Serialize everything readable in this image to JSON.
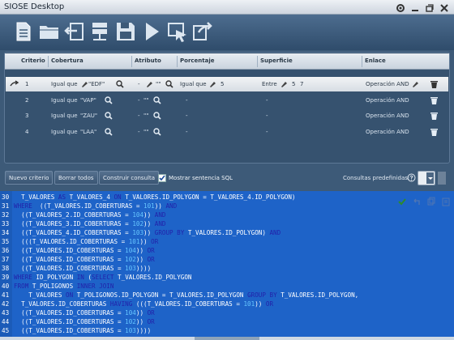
{
  "window": {
    "title": "SIOSE Desktop"
  },
  "toolbar": {
    "buttons": [
      {
        "icon": "new-document-icon"
      },
      {
        "icon": "open-folder-icon"
      },
      {
        "icon": "import-arrow-icon"
      },
      {
        "icon": "database-server-icon"
      },
      {
        "icon": "save-disk-icon"
      },
      {
        "icon": "run-play-icon"
      },
      {
        "icon": "select-cursor-icon"
      },
      {
        "icon": "export-arrow-icon"
      }
    ]
  },
  "grid": {
    "columns": [
      "Criterio",
      "Cobertura",
      "Atributo",
      "Porcentaje",
      "Superficie",
      "Enlace"
    ],
    "rows": [
      {
        "criterio": "1",
        "cobertura": "Igual que ",
        "cobertura_value": "\"EDF\"",
        "atributo": "-",
        "atributo_value": "\"\"",
        "porcentaje": "Igual que",
        "porcentaje_value": "5",
        "superficie": "Entre",
        "sup_min": "5",
        "sup_max": "7",
        "enlace": "Operación AND",
        "selected": true
      },
      {
        "criterio": "2",
        "cobertura": "Igual que ",
        "cobertura_value": "\"VAP\"",
        "atributo": "-",
        "atributo_value": "\"\"",
        "porcentaje": "-",
        "superficie": "-",
        "enlace": "Operación AND",
        "selected": false
      },
      {
        "criterio": "3",
        "cobertura": "Igual que ",
        "cobertura_value": "\"ZAU\"",
        "atributo": "-",
        "atributo_value": "\"\"",
        "porcentaje": "-",
        "superficie": "-",
        "enlace": "Operación AND",
        "selected": false
      },
      {
        "criterio": "4",
        "cobertura": "Igual que ",
        "cobertura_value": "\"LAA\"",
        "atributo": "-",
        "atributo_value": "\"\"",
        "porcentaje": "-",
        "superficie": "-",
        "enlace": "Operación AND",
        "selected": false
      }
    ]
  },
  "actions": {
    "new_criterion": "Nuevo criterio",
    "delete_all": "Borrar todos",
    "build_query": "Construir consulta",
    "show_sql": "Mostrar sentencia SQL",
    "show_sql_checked": true,
    "predefined_label": "Consultas predefinidas:"
  },
  "sql": {
    "lines": [
      {
        "n": "30",
        "t": [
          [
            "  T_VALORES ",
            ""
          ],
          [
            "AS",
            "kw"
          ],
          [
            " T_VALORES_4 ",
            ""
          ],
          [
            "ON",
            "kw"
          ],
          [
            " T_VALORES.ID_POLYGON = T_VALORES_4.ID_POLYGON)",
            ""
          ]
        ]
      },
      {
        "n": "31",
        "t": [
          [
            "WHERE",
            "kw"
          ],
          [
            "  ((T_VALORES.ID_COBERTURAS = ",
            ""
          ],
          [
            "101",
            "num"
          ],
          [
            ")) ",
            ""
          ],
          [
            "AND",
            "kw"
          ]
        ]
      },
      {
        "n": "32",
        "t": [
          [
            "  ((T_VALORES_2.ID_COBERTURAS = ",
            ""
          ],
          [
            "104",
            "num"
          ],
          [
            ")) ",
            ""
          ],
          [
            "AND",
            "kw"
          ]
        ]
      },
      {
        "n": "33",
        "t": [
          [
            "  ((T_VALORES_3.ID_COBERTURAS = ",
            ""
          ],
          [
            "102",
            "num"
          ],
          [
            ")) ",
            ""
          ],
          [
            "AND",
            "kw"
          ]
        ]
      },
      {
        "n": "34",
        "t": [
          [
            "  ((T_VALORES_4.ID_COBERTURAS = ",
            ""
          ],
          [
            "103",
            "num"
          ],
          [
            ")) ",
            ""
          ],
          [
            "GROUP BY",
            "kw"
          ],
          [
            " T_VALORES.ID_POLYGON) ",
            ""
          ],
          [
            "AND",
            "kw"
          ]
        ]
      },
      {
        "n": "35",
        "t": [
          [
            "  (((T_VALORES.ID_COBERTURAS = ",
            ""
          ],
          [
            "101",
            "num"
          ],
          [
            ")) ",
            ""
          ],
          [
            "OR",
            "kw"
          ]
        ]
      },
      {
        "n": "36",
        "t": [
          [
            "  ((T_VALORES.ID_COBERTURAS = ",
            ""
          ],
          [
            "104",
            "num"
          ],
          [
            ")) ",
            ""
          ],
          [
            "OR",
            "kw"
          ]
        ]
      },
      {
        "n": "37",
        "t": [
          [
            "  ((T_VALORES.ID_COBERTURAS = ",
            ""
          ],
          [
            "102",
            "num"
          ],
          [
            ")) ",
            ""
          ],
          [
            "OR",
            "kw"
          ]
        ]
      },
      {
        "n": "38",
        "t": [
          [
            "  ((T_VALORES.ID_COBERTURAS = ",
            ""
          ],
          [
            "103",
            "num"
          ],
          [
            ")))) ",
            ""
          ]
        ]
      },
      {
        "n": "39",
        "t": [
          [
            "WHERE",
            "kw"
          ],
          [
            " ID_POLYGON ",
            ""
          ],
          [
            "IN",
            "kw"
          ],
          [
            " (",
            ""
          ],
          [
            "SELECT",
            "kw"
          ],
          [
            " T_VALORES.ID_POLYGON",
            ""
          ]
        ]
      },
      {
        "n": "40",
        "t": [
          [
            "FROM",
            "kw"
          ],
          [
            " T_POLIGONOS ",
            ""
          ],
          [
            "INNER JOIN",
            "kw"
          ]
        ]
      },
      {
        "n": "41",
        "t": [
          [
            "    T_VALORES ",
            ""
          ],
          [
            "ON",
            "kw"
          ],
          [
            " T_POLIGONOS.ID_POLYGON = T_VALORES.ID_POLYGON ",
            ""
          ],
          [
            "GROUP BY",
            "kw"
          ],
          [
            " T_VALORES.ID_POLYGON,",
            ""
          ]
        ]
      },
      {
        "n": "42",
        "t": [
          [
            "  T_VALORES.ID_COBERTURAS ",
            ""
          ],
          [
            "HAVING",
            "kw"
          ],
          [
            " (((T_VALORES.ID_COBERTURAS = ",
            ""
          ],
          [
            "101",
            "num"
          ],
          [
            ")) ",
            ""
          ],
          [
            "OR",
            "kw"
          ]
        ]
      },
      {
        "n": "43",
        "t": [
          [
            "  ((T_VALORES.ID_COBERTURAS = ",
            ""
          ],
          [
            "104",
            "num"
          ],
          [
            ")) ",
            ""
          ],
          [
            "OR",
            "kw"
          ]
        ]
      },
      {
        "n": "44",
        "t": [
          [
            "  ((T_VALORES.ID_COBERTURAS = ",
            ""
          ],
          [
            "102",
            "num"
          ],
          [
            ")) ",
            ""
          ],
          [
            "OR",
            "kw"
          ]
        ]
      },
      {
        "n": "45",
        "t": [
          [
            "  ((T_VALORES.ID_COBERTURAS = ",
            ""
          ],
          [
            "103",
            "num"
          ],
          [
            "))))",
            ""
          ]
        ]
      }
    ]
  },
  "colors": {
    "editor_bg": "#1e63c8",
    "keyword": "#2222aa",
    "number": "#66c6ff"
  }
}
